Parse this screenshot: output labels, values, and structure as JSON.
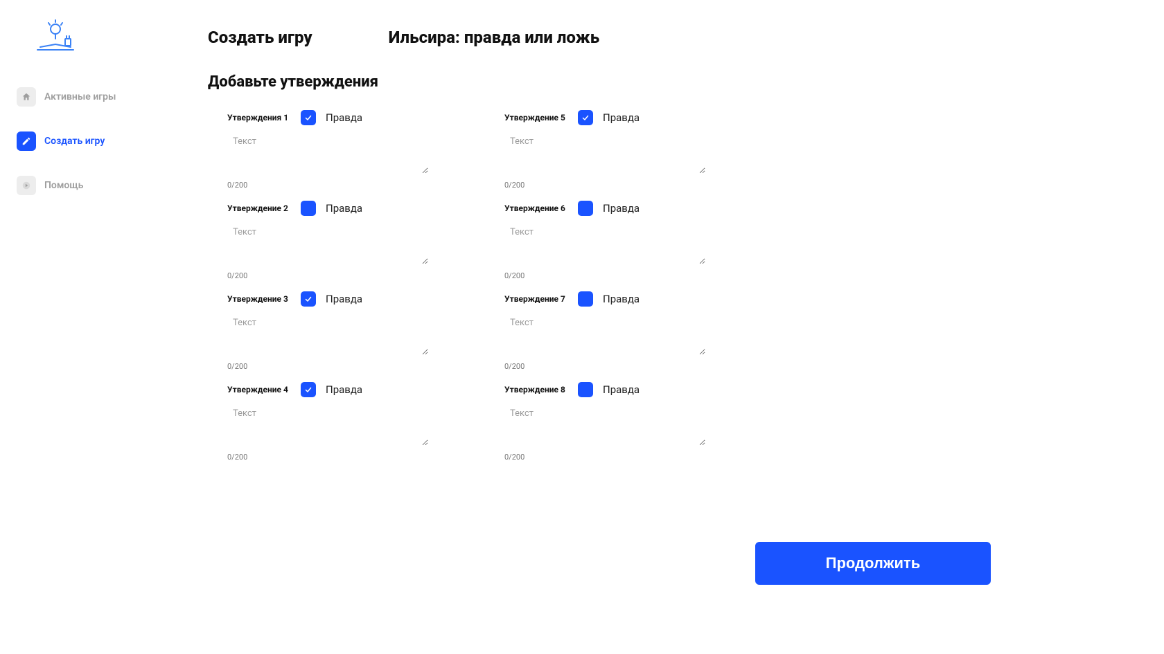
{
  "sidebar": {
    "items": [
      {
        "label": "Активные игры"
      },
      {
        "label": "Создать игру"
      },
      {
        "label": "Помощь"
      }
    ]
  },
  "header": {
    "page_title": "Создать игру",
    "game_title": "Ильсира: правда или ложь"
  },
  "section": {
    "title": "Добавьте утверждения"
  },
  "statements": [
    {
      "label": "Утверждения 1",
      "checked": true,
      "truth": "Правда",
      "placeholder": "Текст",
      "counter": "0/200"
    },
    {
      "label": "Утверждение 2",
      "checked": false,
      "truth": "Правда",
      "placeholder": "Текст",
      "counter": "0/200"
    },
    {
      "label": "Утверждение 3",
      "checked": true,
      "truth": "Правда",
      "placeholder": "Текст",
      "counter": "0/200"
    },
    {
      "label": "Утверждение 4",
      "checked": true,
      "truth": "Правда",
      "placeholder": "Текст",
      "counter": "0/200"
    },
    {
      "label": "Утверждение 5",
      "checked": true,
      "truth": "Правда",
      "placeholder": "Текст",
      "counter": "0/200"
    },
    {
      "label": "Утверждение 6",
      "checked": false,
      "truth": "Правда",
      "placeholder": "Текст",
      "counter": "0/200"
    },
    {
      "label": "Утверждение 7",
      "checked": false,
      "truth": "Правда",
      "placeholder": "Текст",
      "counter": "0/200"
    },
    {
      "label": "Утверждение 8",
      "checked": false,
      "truth": "Правда",
      "placeholder": "Текст",
      "counter": "0/200"
    }
  ],
  "actions": {
    "continue": "Продолжить"
  },
  "colors": {
    "accent": "#1a53ff",
    "muted": "#9e9e9e"
  }
}
